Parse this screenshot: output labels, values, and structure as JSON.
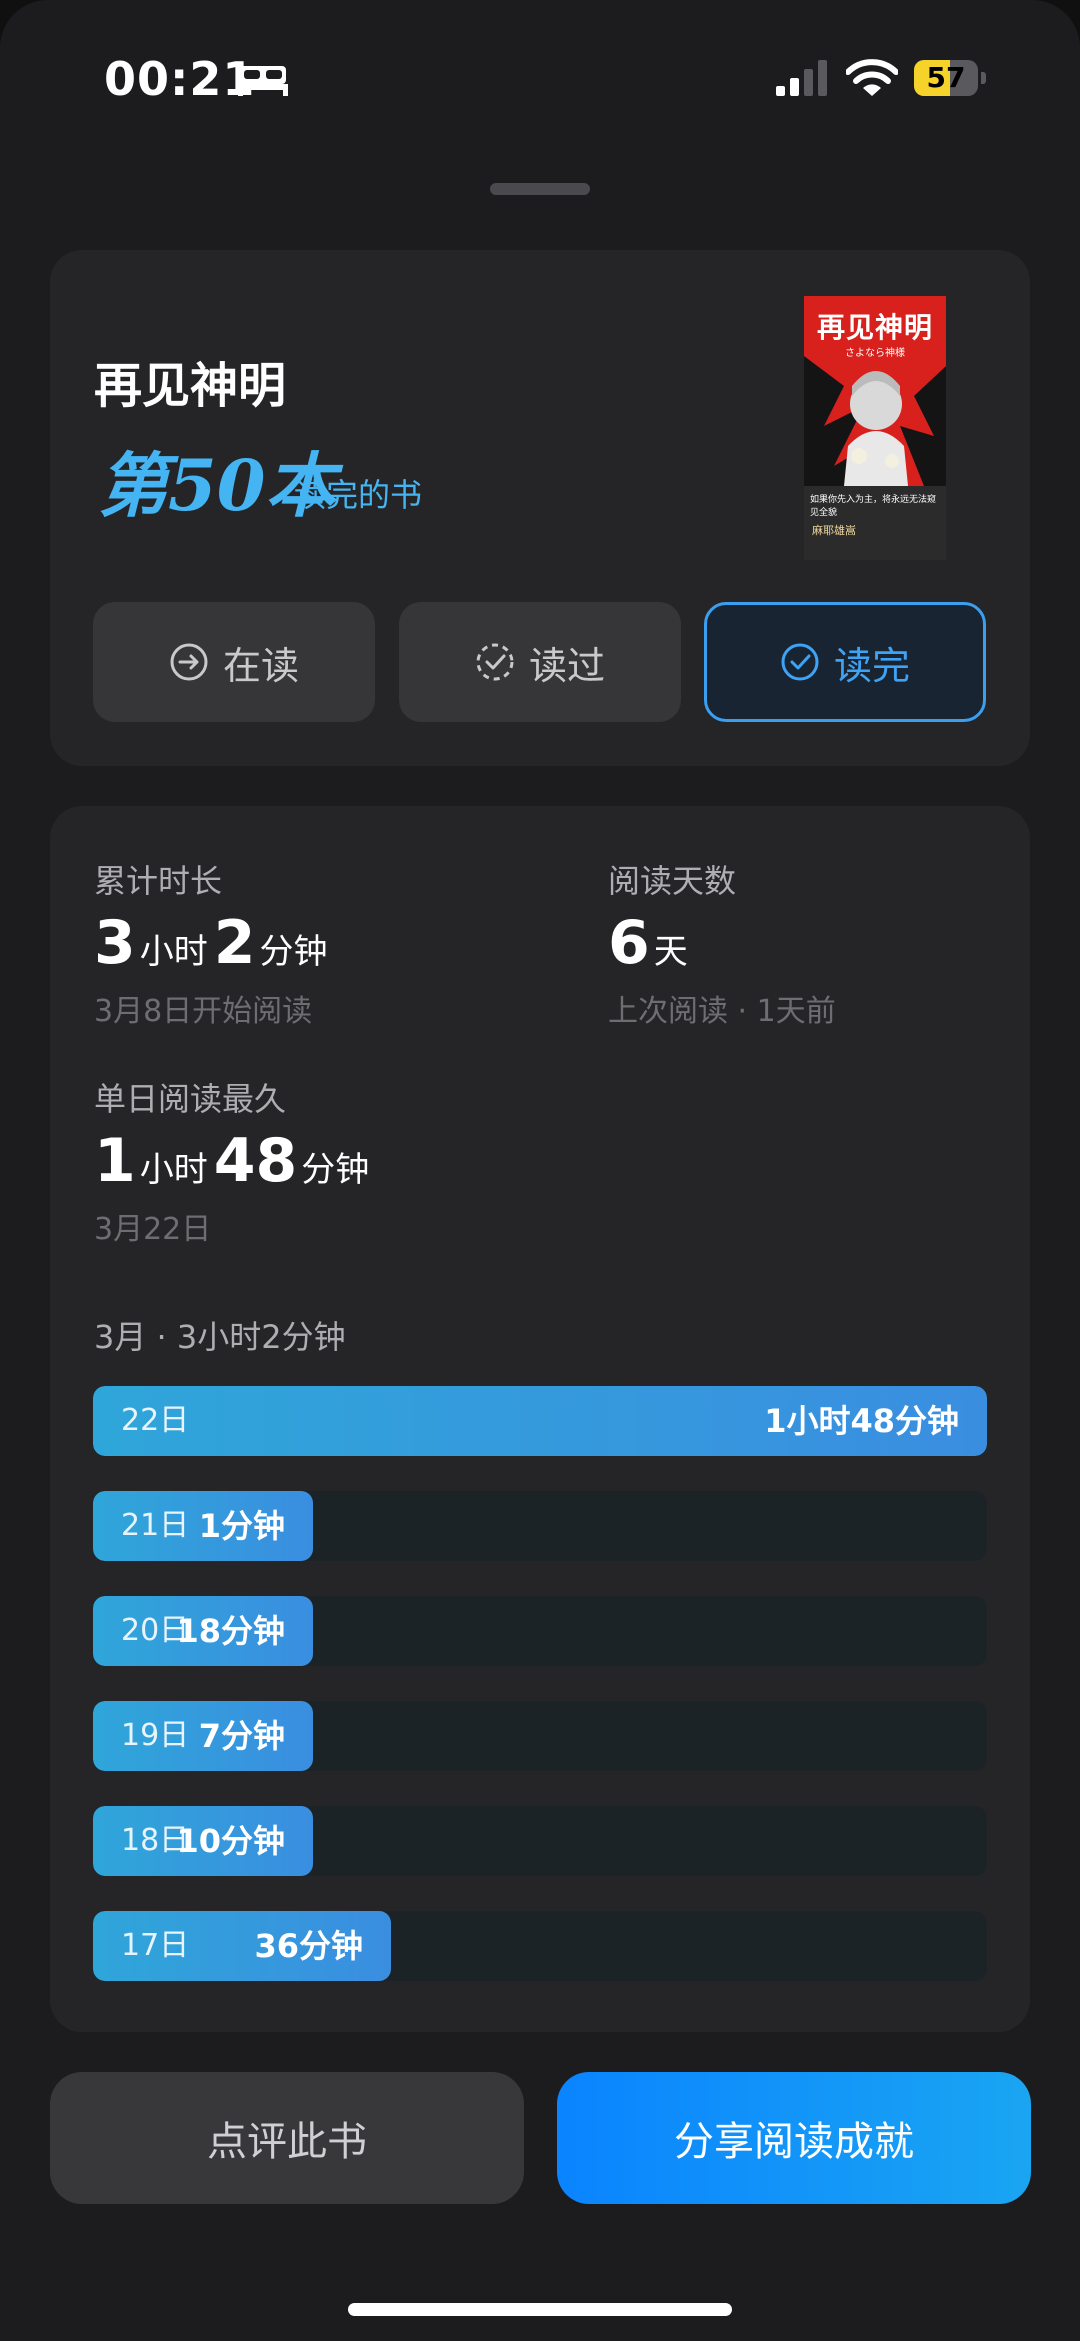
{
  "status_bar": {
    "time": "00:21",
    "battery_percent": 57
  },
  "book": {
    "title": "再见神明",
    "ordinal": "第50本",
    "ordinal_suffix": "读完的书",
    "cover": {
      "title": "再见神明",
      "subtitle": "さよなら神様",
      "tagline": "如果你先入为主，将永远无法窥见全貌",
      "author": "麻耶雄嵩"
    }
  },
  "status_buttons": [
    {
      "label": "在读",
      "icon": "arrow-circle-icon",
      "active": false
    },
    {
      "label": "读过",
      "icon": "dashed-check-circle-icon",
      "active": false
    },
    {
      "label": "读完",
      "icon": "check-circle-icon",
      "active": true
    }
  ],
  "stats": {
    "total": {
      "label": "累计时长",
      "hours": "3",
      "hours_unit": "小时",
      "minutes": "2",
      "minutes_unit": "分钟",
      "sub": "3月8日开始阅读"
    },
    "days": {
      "label": "阅读天数",
      "value": "6",
      "unit": "天",
      "sub": "上次阅读 · 1天前"
    },
    "longest": {
      "label": "单日阅读最久",
      "hours": "1",
      "hours_unit": "小时",
      "minutes": "48",
      "minutes_unit": "分钟",
      "sub": "3月22日"
    }
  },
  "month_summary": "3月 · 3小时2分钟",
  "chart_data": {
    "type": "bar",
    "orientation": "horizontal",
    "categories": [
      "22日",
      "21日",
      "20日",
      "19日",
      "18日",
      "17日"
    ],
    "values": [
      108,
      1,
      18,
      7,
      10,
      36
    ],
    "value_labels": [
      "1小时48分钟",
      "1分钟",
      "18分钟",
      "7分钟",
      "10分钟",
      "36分钟"
    ],
    "xlim": [
      0,
      108
    ],
    "colors": {
      "fill": "#2fa6d9",
      "track": "#1c2327"
    }
  },
  "actions": {
    "review": "点评此书",
    "share": "分享阅读成就"
  },
  "colors": {
    "accent": "#3ea3f5",
    "card": "#252527",
    "background": "#1c1c1e"
  }
}
